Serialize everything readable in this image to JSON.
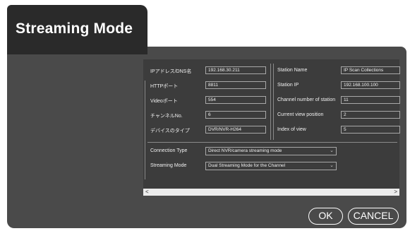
{
  "title": "Streaming Mode",
  "left_fields": [
    {
      "label": "IPアドレス/DNS名",
      "value": "192.168.30.211"
    },
    {
      "label": "HTTPポート",
      "value": "8811"
    },
    {
      "label": "Videoポート",
      "value": "554"
    },
    {
      "label": "チャンネルNo.",
      "value": "6"
    },
    {
      "label": "デバイスのタイプ",
      "value": "DVR/NVR-H264"
    }
  ],
  "right_fields": [
    {
      "label": "Station Name",
      "value": "IP Scan Collections"
    },
    {
      "label": "Station IP",
      "value": "192.168.100.100"
    },
    {
      "label": "Channel number of station",
      "value": "11"
    },
    {
      "label": "Current view position",
      "value": "2"
    },
    {
      "label": "Index of view",
      "value": "5"
    }
  ],
  "connection_type": {
    "label": "Connection Type",
    "value": "Direct NVR/camera streaming mode"
  },
  "streaming_mode": {
    "label": "Streaming Mode",
    "value": "Dual Streaming Mode for the Channel"
  },
  "scrollbar": {
    "left_arrow": "<",
    "right_arrow": ">"
  },
  "buttons": {
    "ok": "OK",
    "cancel": "CANCEL"
  },
  "icons": {
    "dropdown": "chevron-down-icon"
  }
}
